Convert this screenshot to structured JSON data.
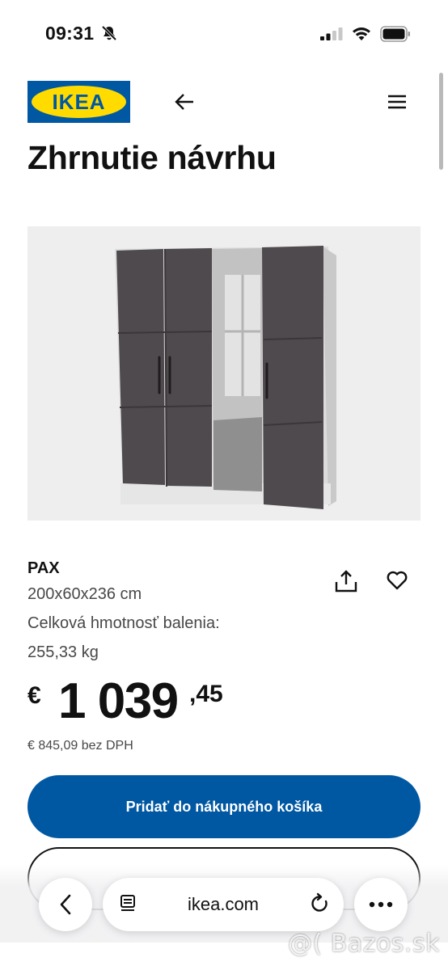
{
  "status_bar": {
    "time": "09:31",
    "icons": [
      "bell-slash-icon",
      "cellular-signal-icon",
      "wifi-icon",
      "battery-icon"
    ]
  },
  "header": {
    "logo_text": "IKEA",
    "logo_colors": {
      "blue": "#0058a3",
      "yellow": "#ffdb00"
    },
    "back_icon": "arrow-left-icon",
    "menu_icon": "hamburger-menu-icon"
  },
  "page": {
    "title": "Zhrnutie návrhu"
  },
  "product": {
    "name": "PAX",
    "dimensions": "200x60x236 cm",
    "weight_label": "Celková hmotnosť balenia:",
    "weight_value": "255,33 kg",
    "share_icon": "share-icon",
    "favorite_icon": "heart-icon",
    "image_description_icon": "wardrobe-image"
  },
  "price": {
    "currency": "€",
    "integer": "1 039",
    "decimal": ",45",
    "net_price": "€ 845,09 bez DPH"
  },
  "actions": {
    "add_to_cart": "Pridať do nákupného košíka",
    "add_to_cart_color": "#0058a3"
  },
  "browser": {
    "url": "ikea.com",
    "back_icon": "chevron-left-icon",
    "reader_icon": "reader-mode-icon",
    "reload_icon": "reload-icon",
    "more_icon": "more-dots-icon"
  },
  "watermark": {
    "text": "@( Bazos.sk"
  }
}
